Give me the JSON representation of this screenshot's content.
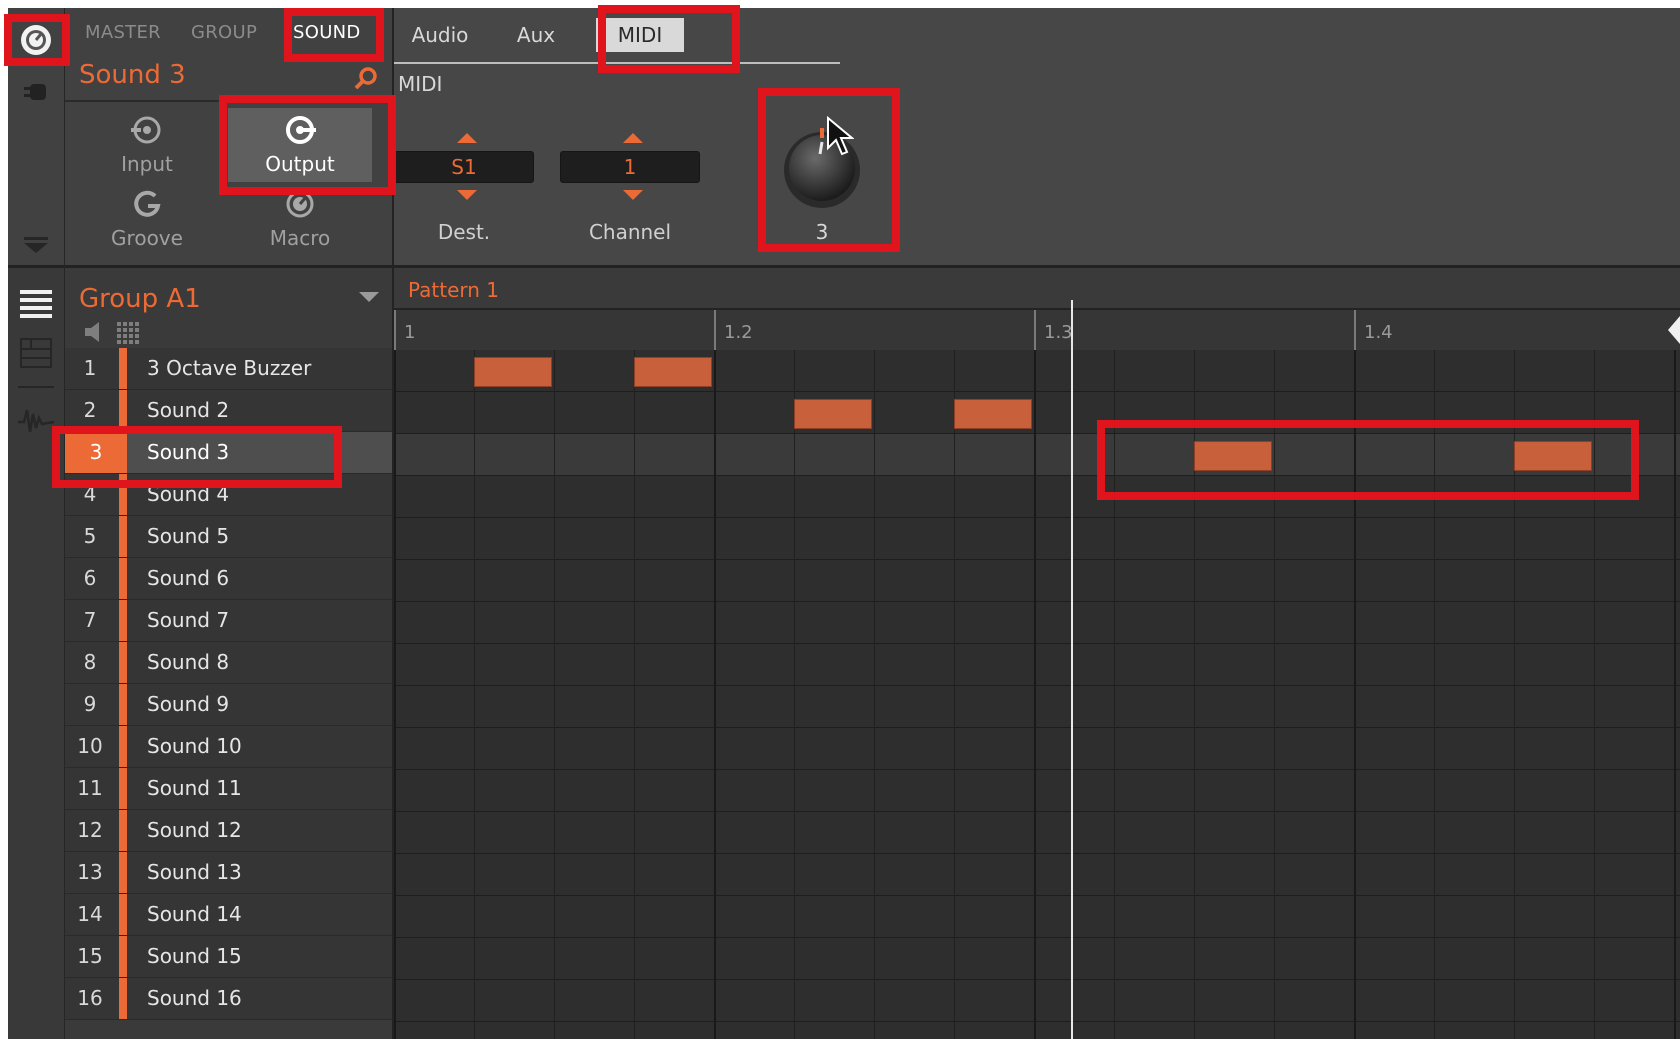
{
  "area_tabs": {
    "master": "MASTER",
    "group": "GROUP",
    "sound": "SOUND"
  },
  "sound_name": "Sound 3",
  "page_buttons": {
    "input": "Input",
    "output": "Output",
    "groove": "Groove",
    "macro": "Macro"
  },
  "sub_tabs": {
    "audio": "Audio",
    "aux": "Aux",
    "midi": "MIDI"
  },
  "section_label": "MIDI",
  "params": {
    "dest": {
      "value": "S1",
      "label": "Dest."
    },
    "channel": {
      "value": "1",
      "label": "Channel"
    },
    "knob": {
      "value": "3"
    }
  },
  "group_name": "Group A1",
  "pattern_name": "Pattern 1",
  "ruler_marks": [
    "1",
    "1.2",
    "1.3",
    "1.4"
  ],
  "sounds": [
    {
      "num": "1",
      "name": "3 Octave Buzzer"
    },
    {
      "num": "2",
      "name": "Sound 2"
    },
    {
      "num": "3",
      "name": "Sound 3"
    },
    {
      "num": "4",
      "name": "Sound 4"
    },
    {
      "num": "5",
      "name": "Sound 5"
    },
    {
      "num": "6",
      "name": "Sound 6"
    },
    {
      "num": "7",
      "name": "Sound 7"
    },
    {
      "num": "8",
      "name": "Sound 8"
    },
    {
      "num": "9",
      "name": "Sound 9"
    },
    {
      "num": "10",
      "name": "Sound 10"
    },
    {
      "num": "11",
      "name": "Sound 11"
    },
    {
      "num": "12",
      "name": "Sound 12"
    },
    {
      "num": "13",
      "name": "Sound 13"
    },
    {
      "num": "14",
      "name": "Sound 14"
    },
    {
      "num": "15",
      "name": "Sound 15"
    },
    {
      "num": "16",
      "name": "Sound 16"
    }
  ],
  "selected_sound_index": 2,
  "accent_color": "#ec6a35",
  "highlight_color": "#e0141c",
  "icons": [
    "plugin-icon",
    "plug-icon",
    "collapse-arrow-icon",
    "list-view-icon",
    "keyboard-view-icon",
    "waveform-icon",
    "mute-icon",
    "grid-icon",
    "search-icon",
    "group-dropdown-icon",
    "loop-end-icon"
  ]
}
